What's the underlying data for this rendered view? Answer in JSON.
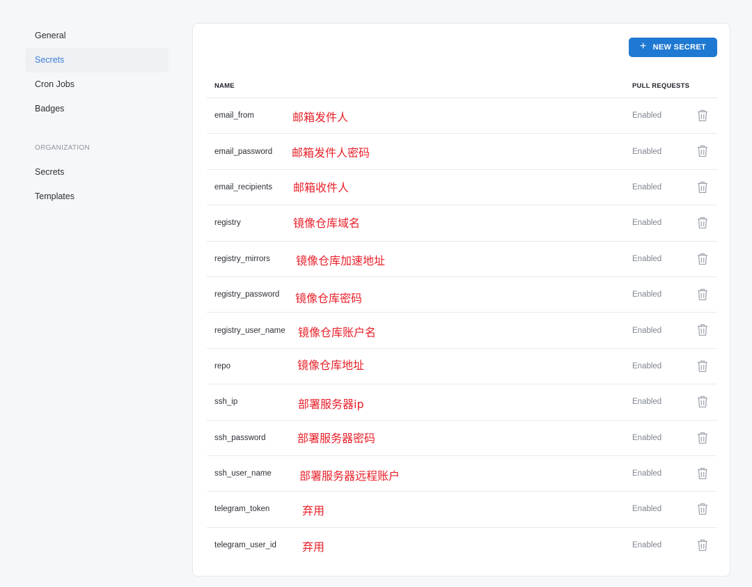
{
  "sidebar": {
    "items": [
      {
        "label": "General",
        "active": false
      },
      {
        "label": "Secrets",
        "active": true
      },
      {
        "label": "Cron Jobs",
        "active": false
      },
      {
        "label": "Badges",
        "active": false
      }
    ],
    "org_heading": "ORGANIZATION",
    "org_items": [
      {
        "label": "Secrets"
      },
      {
        "label": "Templates"
      }
    ]
  },
  "toolbar": {
    "new_secret_label": "NEW SECRET",
    "plus_icon": "plus-icon"
  },
  "table": {
    "headers": {
      "name": "NAME",
      "pull_requests": "PULL REQUESTS"
    },
    "rows": [
      {
        "name": "email_from",
        "annotation": "邮箱发件人",
        "status": "Enabled"
      },
      {
        "name": "email_password",
        "annotation": "邮箱发件人密码",
        "status": "Enabled"
      },
      {
        "name": "email_recipients",
        "annotation": "邮箱收件人",
        "status": "Enabled"
      },
      {
        "name": "registry",
        "annotation": "镜像仓库域名",
        "status": "Enabled"
      },
      {
        "name": "registry_mirrors",
        "annotation": "镜像仓库加速地址",
        "status": "Enabled"
      },
      {
        "name": "registry_password",
        "annotation": "镜像仓库密码",
        "status": "Enabled"
      },
      {
        "name": "registry_user_name",
        "annotation": "镜像仓库账户名",
        "status": "Enabled"
      },
      {
        "name": "repo",
        "annotation": "镜像仓库地址",
        "status": "Enabled"
      },
      {
        "name": "ssh_ip",
        "annotation": "部署服务器ip",
        "status": "Enabled"
      },
      {
        "name": "ssh_password",
        "annotation": "部署服务器密码",
        "status": "Enabled"
      },
      {
        "name": "ssh_user_name",
        "annotation": "部署服务器远程账户",
        "status": "Enabled"
      },
      {
        "name": "telegram_token",
        "annotation": "弃用",
        "status": "Enabled"
      },
      {
        "name": "telegram_user_id",
        "annotation": "弃用",
        "status": "Enabled"
      }
    ]
  },
  "colors": {
    "accent": "#1f78d1",
    "active_nav_text": "#3d7fd6",
    "annotation": "#e8202a",
    "status_text": "#7f858f",
    "trash_icon": "#a0a6b0"
  }
}
